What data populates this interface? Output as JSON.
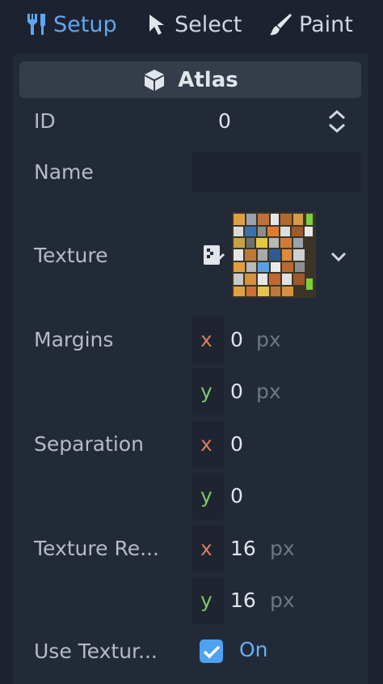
{
  "toolbar": {
    "setup_label": "Setup",
    "select_label": "Select",
    "paint_label": "Paint",
    "active_tool": "setup",
    "accent_color": "#5fa8f0"
  },
  "section": {
    "title": "Atlas",
    "icon": "cube-icon"
  },
  "fields": {
    "id": {
      "label": "ID",
      "value": "0"
    },
    "name": {
      "label": "Name",
      "value": ""
    },
    "texture": {
      "label": "Texture",
      "icon": "texture-edit-icon",
      "dropdown_icon": "chevron-down-icon"
    },
    "margins": {
      "label": "Margins",
      "x_axis": "x",
      "y_axis": "y",
      "x": "0",
      "y": "0",
      "unit": "px"
    },
    "separation": {
      "label": "Separation",
      "x_axis": "x",
      "y_axis": "y",
      "x": "0",
      "y": "0"
    },
    "texture_region": {
      "label": "Texture Re...",
      "x_axis": "x",
      "y_axis": "y",
      "x": "16",
      "y": "16",
      "unit": "px"
    },
    "use_texture": {
      "label": "Use Textur...",
      "checked": true,
      "value_label": "On"
    }
  }
}
